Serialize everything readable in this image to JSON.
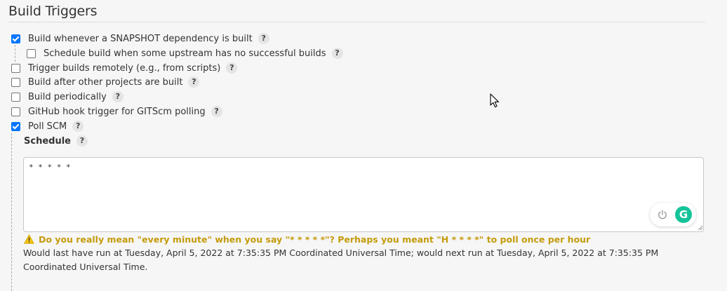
{
  "section": {
    "title": "Build Triggers"
  },
  "help_glyph": "?",
  "triggers": [
    {
      "label": "Build whenever a SNAPSHOT dependency is built",
      "checked": true
    },
    {
      "label": "Schedule build when some upstream has no successful builds",
      "checked": false
    },
    {
      "label": "Trigger builds remotely (e.g., from scripts)",
      "checked": false
    },
    {
      "label": "Build after other projects are built",
      "checked": false
    },
    {
      "label": "Build periodically",
      "checked": false
    },
    {
      "label": "GitHub hook trigger for GITScm polling",
      "checked": false
    },
    {
      "label": "Poll SCM",
      "checked": true
    }
  ],
  "schedule": {
    "label": "Schedule",
    "value": "* * * * *",
    "warning": "Do you really mean \"every minute\" when you say \"* * * * *\"? Perhaps you meant \"H * * * *\" to poll once per hour",
    "info": "Would last have run at Tuesday, April 5, 2022 at 7:35:35 PM Coordinated Universal Time; would next run at Tuesday, April 5, 2022 at 7:35:35 PM Coordinated Universal Time."
  },
  "grammarly": {
    "logo_letter": "G"
  },
  "colors": {
    "accent": "#0075ff",
    "warning": "#c49b0b",
    "grammarly": "#15c39a",
    "background": "#f6f6f6"
  },
  "icons": [
    "question-help-icon",
    "warning-icon",
    "power-icon",
    "grammarly-logo-icon",
    "mouse-cursor-icon",
    "resize-grip-icon"
  ]
}
